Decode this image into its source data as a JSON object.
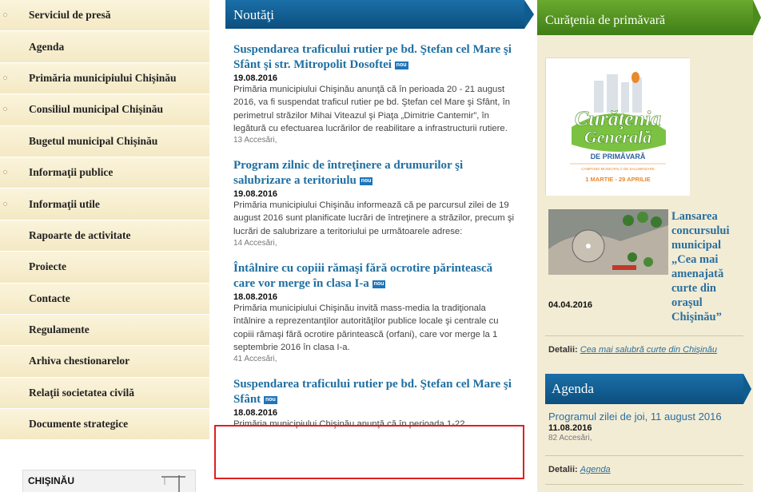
{
  "nav": {
    "items": [
      {
        "label": "Serviciul de presă",
        "bullet": true
      },
      {
        "label": "Agenda",
        "bullet": false
      },
      {
        "label": "Primăria municipiului Chișinău",
        "bullet": true
      },
      {
        "label": "Consiliul municipal Chișinău",
        "bullet": true
      },
      {
        "label": "Bugetul municipal Chișinău",
        "bullet": false
      },
      {
        "label": "Informaţii publice",
        "bullet": true
      },
      {
        "label": "Informaţii utile",
        "bullet": true
      },
      {
        "label": "Rapoarte de activitate",
        "bullet": false
      },
      {
        "label": "Proiecte",
        "bullet": false
      },
      {
        "label": "Contacte",
        "bullet": false
      },
      {
        "label": "Regulamente",
        "bullet": false
      },
      {
        "label": "Arhiva chestionarelor",
        "bullet": false
      },
      {
        "label": "Relaţii societatea civilă",
        "bullet": false
      },
      {
        "label": "Documente strategice",
        "bullet": false
      }
    ],
    "city_box_label": "CHIŞINĂU"
  },
  "news": {
    "header": "Noutăţi",
    "badge": "nou",
    "items": [
      {
        "title": "Suspendarea traficului rutier pe bd. Ştefan cel Mare şi Sfânt şi str. Mitropolit Dosoftei",
        "date": "19.08.2016",
        "body": "Primăria municipiului Chişinău anunţă că în perioada 20 - 21 august 2016, va fi suspendat traficul rutier pe bd. Ştefan cel Mare şi Sfânt, în perimetrul străzilor Mihai Viteazul şi Piaţa „Dimitrie Cantemir”, în legătură cu efectuarea lucrărilor de reabilitare a infrastructurii rutiere.",
        "views": "13 Accesări,"
      },
      {
        "title": "Program zilnic de întreţinere a drumurilor şi salubrizare a teritoriulu",
        "date": "19.08.2016",
        "body": "Primăria municipiului Chişinău informează că pe parcursul zilei de 19 august 2016 sunt planificate lucrări de întreţinere a străzilor, precum şi lucrări de salubrizare a teritoriului pe următoarele adrese:",
        "views": "14 Accesări,"
      },
      {
        "title": "Întâlnire cu copiii rămaşi fără ocrotire părintească care vor merge în clasa I-a",
        "date": "18.08.2016",
        "body": "Primăria municipiului Chişinău invită mass-media la tradiţionala întâlnire a reprezentanţilor autorităţilor publice locale şi centrale cu copiii rămaşi fără ocrotire părintească (orfani), care vor merge la 1 septembrie 2016 în clasa I-a.",
        "views": "41 Accesări,"
      },
      {
        "title": "Suspendarea traficului rutier pe bd. Ştefan cel Mare şi Sfânt",
        "date": "18.08.2016",
        "body": "Primăria municipiului Chişinău anunţă că în perioada 1-22",
        "views": ""
      }
    ]
  },
  "right": {
    "header": "Curăţenia de primăvară",
    "poster": {
      "line1": "Curăţenia",
      "line2": "Generală",
      "line3": "DE PRIMĂVARĂ",
      "line4": "CAMPANIE MUNICIPALĂ DE SALUBRIZARE",
      "line5": "1 MARTIE - 29 APRILIE"
    },
    "article_title": "Lansarea concursului municipal „Cea mai amenajată curte din oraşul Chişinău”",
    "article_date": "04.04.2016",
    "detail_label": "Detalii:",
    "detail_link": "Cea mai salubră curte din Chişinău",
    "agenda_header": "Agenda",
    "agenda_title": "Programul zilei de joi, 11 august 2016",
    "agenda_date": "11.08.2016",
    "agenda_views": "82 Accesări,",
    "agenda_detail_label": "Detalii:",
    "agenda_detail_link": "Agenda"
  }
}
